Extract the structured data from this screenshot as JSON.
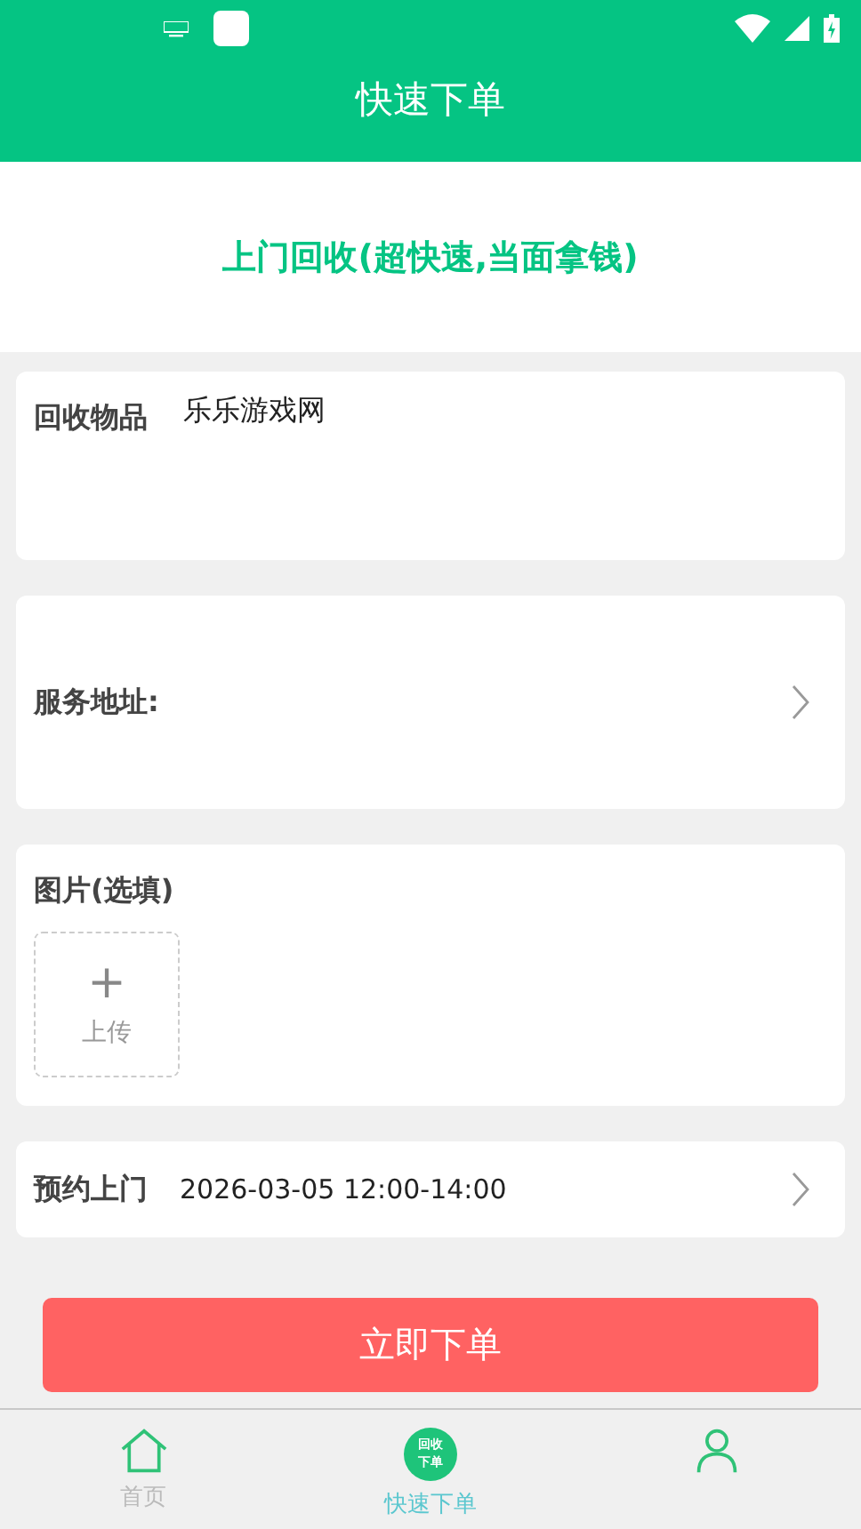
{
  "header": {
    "title": "快速下单"
  },
  "banner": {
    "title": "上门回收(超快速,当面拿钱)"
  },
  "item_card": {
    "label": "回收物品",
    "value": "乐乐游戏网"
  },
  "address_card": {
    "label": "服务地址:"
  },
  "photo_card": {
    "label": "图片(选填)",
    "upload_icon": "+",
    "upload_label": "上传"
  },
  "appointment_card": {
    "label": "预约上门",
    "value": "2026-03-05 12:00-14:00"
  },
  "submit_button": {
    "label": "立即下单"
  },
  "tabs": [
    {
      "kind": "home",
      "label": "首页",
      "selected": false
    },
    {
      "kind": "badge",
      "badge_lines": [
        "回收",
        "下单"
      ],
      "label": "快速下单",
      "selected": true
    },
    {
      "kind": "person",
      "selected": false
    }
  ]
}
